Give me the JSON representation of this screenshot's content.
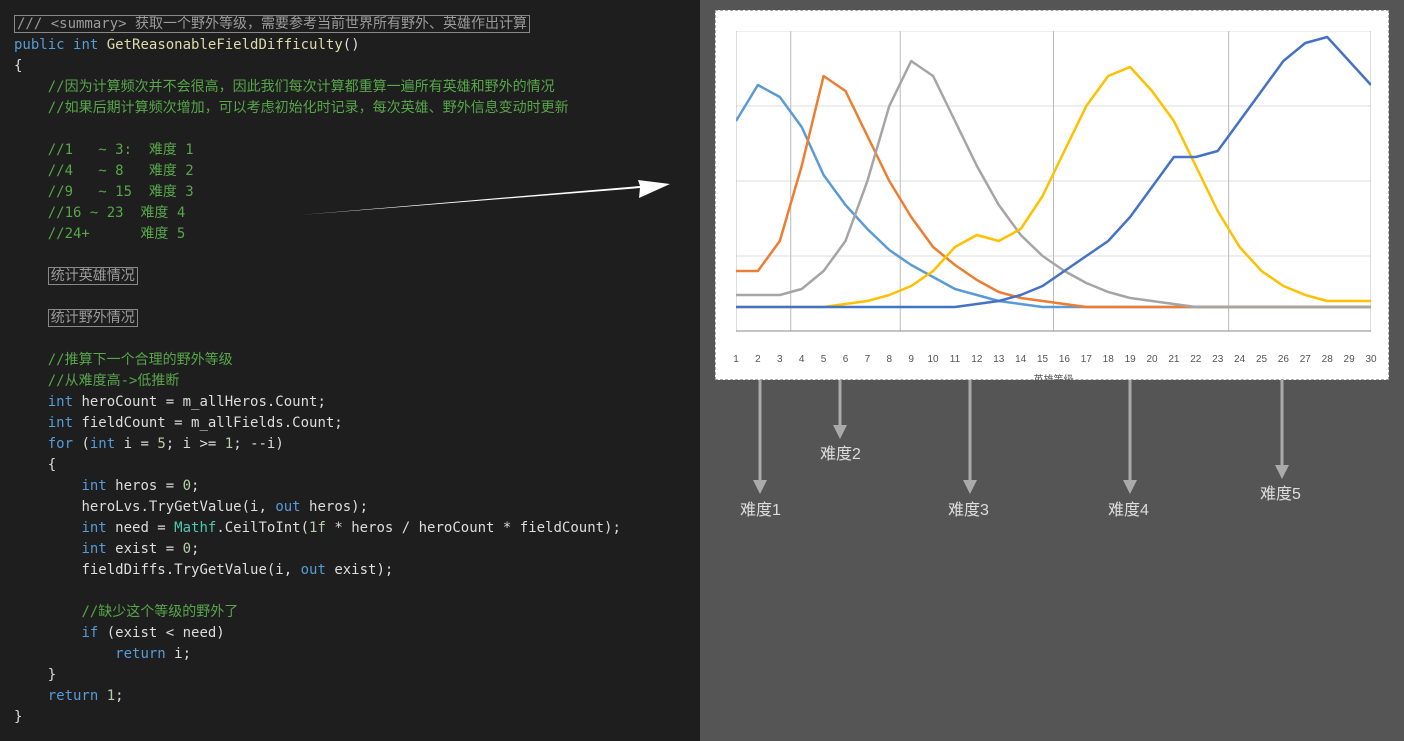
{
  "code": {
    "summary_open": "/// <summary>",
    "summary_text": " 获取一个野外等级，需要参考当前世界所有野外、英雄作出计算",
    "sig_public": "public",
    "sig_int": "int",
    "sig_name": "GetReasonableFieldDifficulty",
    "c1": "//因为计算频次并不会很高，因此我们每次计算都重算一遍所有英雄和野外的情况",
    "c2": "//如果后期计算频次增加，可以考虑初始化时记录，每次英雄、野外信息变动时更新",
    "c3": "//1   ~ 3:  难度 1",
    "c4": "//4   ~ 8   难度 2",
    "c5": "//9   ~ 15  难度 3",
    "c6": "//16 ~ 23  难度 4",
    "c7": "//24+      难度 5",
    "box1": "统计英雄情况",
    "box2": "统计野外情况",
    "c8": "//推算下一个合理的野外等级",
    "c9": "//从难度高->低推断",
    "l1a": "int",
    "l1b": " heroCount = m_allHeros.Count;",
    "l2a": "int",
    "l2b": " fieldCount = m_allFields.Count;",
    "l3a": "for",
    "l3b": " (",
    "l3c": "int",
    "l3d": " i = ",
    "l3e": "5",
    "l3f": "; i >= ",
    "l3g": "1",
    "l3h": "; --i)",
    "l4a": "int",
    "l4b": " heros = ",
    "l4c": "0",
    "l4d": ";",
    "l5": "heroLvs.TryGetValue(i, ",
    "l5a": "out",
    "l5b": " heros);",
    "l6a": "int",
    "l6b": " need = ",
    "l6c": "Mathf",
    "l6d": ".CeilToInt(",
    "l6e": "1f",
    "l6f": " * heros / heroCount * fieldCount);",
    "l7a": "int",
    "l7b": " exist = ",
    "l7c": "0",
    "l7d": ";",
    "l8": "fieldDiffs.TryGetValue(i, ",
    "l8a": "out",
    "l8b": " exist);",
    "c10": "//缺少这个等级的野外了",
    "l9a": "if",
    "l9b": " (exist < need)",
    "l10a": "return",
    "l10b": " i;",
    "l11a": "return",
    "l11b": " ",
    "l11c": "1",
    "l11d": ";"
  },
  "chart_data": {
    "type": "line",
    "xlabel": "英雄等级",
    "x": [
      1,
      2,
      3,
      4,
      5,
      6,
      7,
      8,
      9,
      10,
      11,
      12,
      13,
      14,
      15,
      16,
      17,
      18,
      19,
      20,
      21,
      22,
      23,
      24,
      25,
      26,
      27,
      28,
      29,
      30
    ],
    "series": [
      {
        "name": "难度1",
        "color": "#5b9bd5",
        "values": [
          70,
          82,
          78,
          68,
          52,
          42,
          34,
          27,
          22,
          18,
          14,
          12,
          10,
          9,
          8,
          8,
          8,
          8,
          8,
          8,
          8,
          8,
          8,
          8,
          8,
          8,
          8,
          8,
          8,
          8
        ]
      },
      {
        "name": "难度2",
        "color": "#ed7d31",
        "values": [
          20,
          20,
          30,
          55,
          85,
          80,
          65,
          50,
          38,
          28,
          22,
          17,
          13,
          11,
          10,
          9,
          8,
          8,
          8,
          8,
          8,
          8,
          8,
          8,
          8,
          8,
          8,
          8,
          8,
          8
        ]
      },
      {
        "name": "难度3",
        "color": "#a5a5a5",
        "values": [
          12,
          12,
          12,
          14,
          20,
          30,
          50,
          75,
          90,
          85,
          70,
          55,
          42,
          32,
          25,
          20,
          16,
          13,
          11,
          10,
          9,
          8,
          8,
          8,
          8,
          8,
          8,
          8,
          8,
          8
        ]
      },
      {
        "name": "难度4",
        "color": "#ffc000",
        "values": [
          8,
          8,
          8,
          8,
          8,
          9,
          10,
          12,
          15,
          20,
          28,
          32,
          30,
          34,
          45,
          60,
          75,
          85,
          88,
          80,
          70,
          55,
          40,
          28,
          20,
          15,
          12,
          10,
          10,
          10
        ]
      },
      {
        "name": "难度5",
        "color": "#4472c4",
        "values": [
          8,
          8,
          8,
          8,
          8,
          8,
          8,
          8,
          8,
          8,
          8,
          9,
          10,
          12,
          15,
          20,
          25,
          30,
          38,
          48,
          58,
          58,
          60,
          70,
          80,
          90,
          96,
          98,
          90,
          82
        ]
      }
    ],
    "ylim": [
      0,
      100
    ],
    "xlim": [
      1,
      30
    ],
    "boundaries": [
      3,
      8,
      15,
      23
    ]
  },
  "annotations": {
    "a1": "难度1",
    "a2": "难度2",
    "a3": "难度3",
    "a4": "难度4",
    "a5": "难度5"
  }
}
